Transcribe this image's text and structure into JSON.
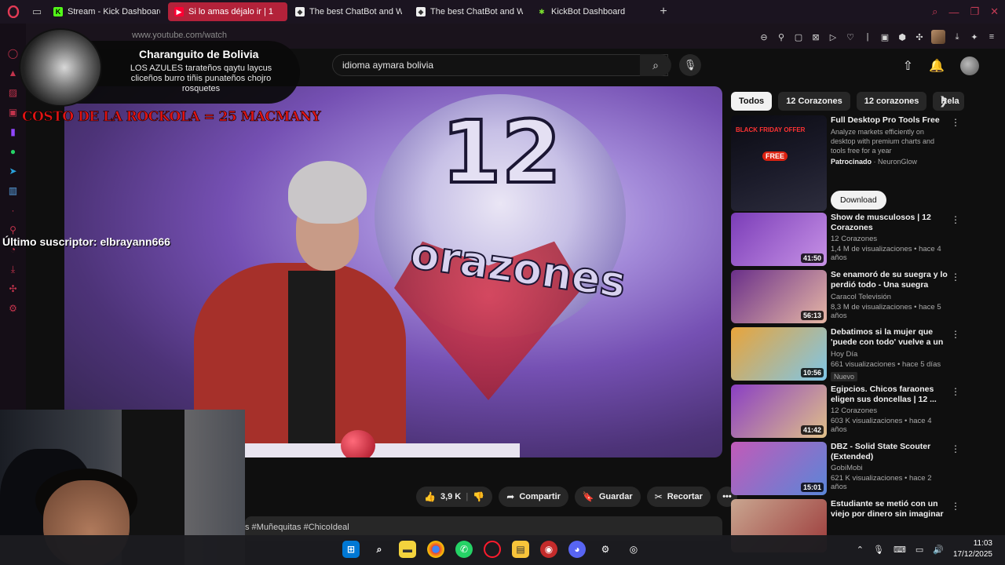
{
  "browser": {
    "tabs": [
      {
        "title": "Stream - Kick Dashboard",
        "active": false,
        "favicon": "kick-icon"
      },
      {
        "title": "Si lo amas déjalo ir | 1",
        "active": true,
        "favicon": "youtube-icon"
      },
      {
        "title": "The best ChatBot and Wi",
        "active": false,
        "favicon": "bot-icon"
      },
      {
        "title": "The best ChatBot and Wi",
        "active": false,
        "favicon": "bot-icon"
      },
      {
        "title": "KickBot Dashboard",
        "active": false,
        "favicon": "kickbot-icon"
      }
    ],
    "url": "www.youtube.com/watch",
    "accent": "#b3223a"
  },
  "youtube": {
    "search_value": "idioma aymara bolivia",
    "chips": [
      "Todos",
      "12 Corazones",
      "12 corazones",
      "Rela"
    ],
    "actions": {
      "like_count": "3,9 K",
      "share": "Compartir",
      "save": "Guardar",
      "clip": "Recortar"
    },
    "hashtags": "s #Muñequitas #ChicoIdeal",
    "ad": {
      "title": "Full Desktop Pro Tools Free",
      "description": "Analyze markets efficiently on desktop with premium charts and tools free for a year",
      "sponsored_label": "Patrocinado",
      "advertiser": "NeuronGlow",
      "cta": "Download",
      "thumb_line1": "BLACK FRIDAY OFFER",
      "thumb_line2": "FREE"
    },
    "recommendations": [
      {
        "title": "Show de musculosos | 12 Corazones",
        "channel": "12 Corazones",
        "meta": "1,4 M de visualizaciones • hace 4 años",
        "duration": "41:50",
        "badge": "",
        "colors": [
          "#7b3db8",
          "#c792e6"
        ]
      },
      {
        "title": "Se enamoró de su suegra y lo perdió todo - Una suegra com...",
        "channel": "Caracol Televisión",
        "meta": "8,3 M de visualizaciones • hace 5 años",
        "duration": "56:13",
        "badge": "",
        "colors": [
          "#6a2f8a",
          "#e6b7a5"
        ]
      },
      {
        "title": "Debatimos si la mujer que 'puede con todo' vuelve a un ...",
        "channel": "Hoy Día",
        "meta": "661 visualizaciones • hace 5 días",
        "duration": "10:56",
        "badge": "Nuevo",
        "colors": [
          "#e9a43a",
          "#7ec6e8"
        ]
      },
      {
        "title": "Egipcios. Chicos faraones eligen sus doncellas | 12 ...",
        "channel": "12 Corazones",
        "meta": "603 K visualizaciones • hace 4 años",
        "duration": "41:42",
        "badge": "",
        "colors": [
          "#8a3fc4",
          "#e0c088"
        ]
      },
      {
        "title": "DBZ - Solid State Scouter (Extended)",
        "channel": "GobiMobi",
        "meta": "621 K visualizaciones • hace 2 años",
        "duration": "15:01",
        "badge": "",
        "colors": [
          "#c25ab8",
          "#5a86d8"
        ]
      },
      {
        "title": "Estudiante se metió con un viejo por dinero sin imaginar l...",
        "channel": "",
        "meta": "",
        "duration": "",
        "badge": "",
        "colors": [
          "#c9a690",
          "#9c3a3a"
        ]
      }
    ]
  },
  "overlay": {
    "name": "Charanguito de Bolivia",
    "description": "LOS AZULES tarateños qaytu laycus cliceños burro tiñis punateños chojro rosquetes",
    "rockola": "COSTO DE LA ROCKOLA = 25 MACMANY",
    "last_subscriber": "Último suscriptor: elbrayann666"
  },
  "taskbar": {
    "time": "11:03",
    "date": "17/12/2025"
  }
}
